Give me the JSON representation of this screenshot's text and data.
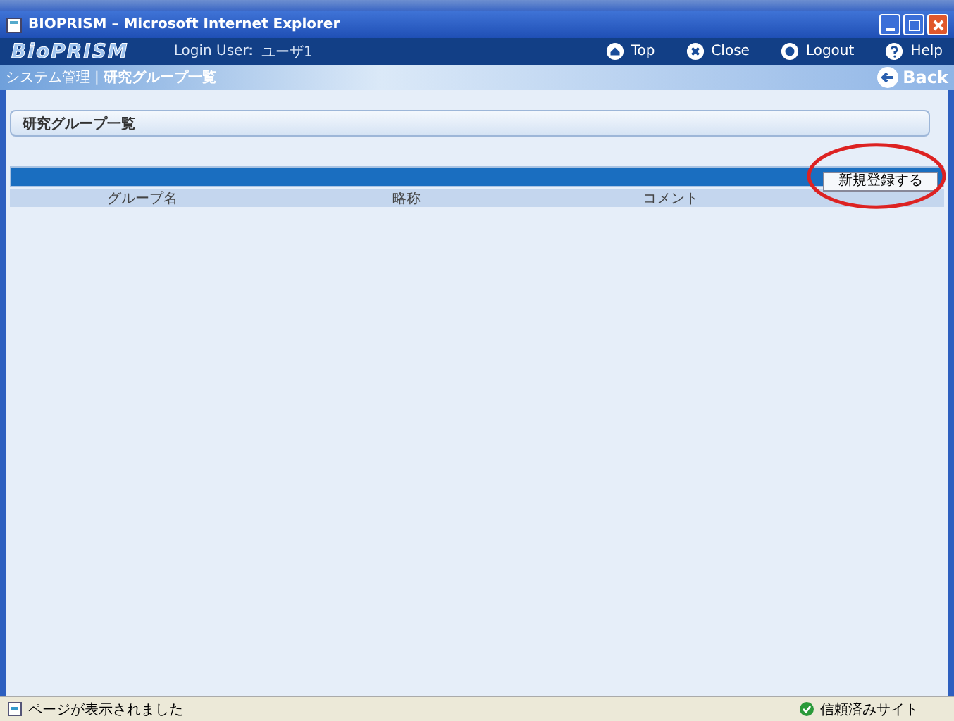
{
  "window": {
    "title": "BIOPRISM – Microsoft Internet Explorer"
  },
  "header": {
    "logo": "BioPRISM",
    "login_label": "Login User:",
    "login_user": "ユーザ1",
    "nav": [
      {
        "kind": "top",
        "label": "Top"
      },
      {
        "kind": "close",
        "label": "Close"
      },
      {
        "kind": "logout",
        "label": "Logout"
      },
      {
        "kind": "help",
        "label": "Help"
      }
    ]
  },
  "breadcrumb": {
    "items": [
      "システム管理",
      "研究グループ一覧"
    ],
    "separator": "|",
    "back": "Back"
  },
  "section_title": "研究グループ一覧",
  "toolbar": {
    "new_button": "新規登録する",
    "highlighted": true
  },
  "table": {
    "columns": [
      "グループ名",
      "略称",
      "コメント"
    ]
  },
  "status_bar": {
    "message": "ページが表示されました",
    "zone": "信頼済みサイト"
  }
}
